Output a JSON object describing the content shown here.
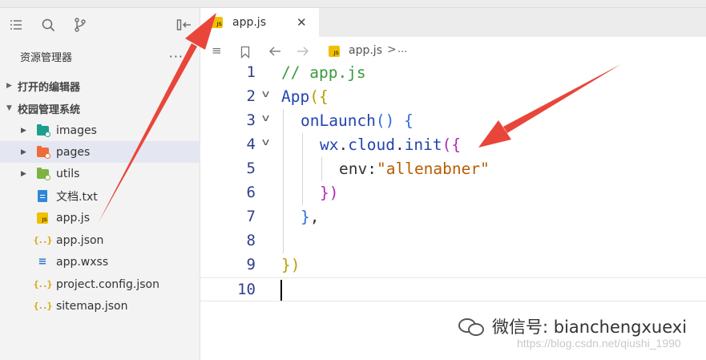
{
  "sidebar": {
    "title": "资源管理器",
    "more": "···",
    "sections": [
      {
        "label": "打开的编辑器"
      },
      {
        "label": "校园管理系统"
      }
    ],
    "items": [
      {
        "label": "images",
        "type": "folder",
        "color": "#1e9e8f"
      },
      {
        "label": "pages",
        "type": "folder",
        "color": "#f06b3b"
      },
      {
        "label": "utils",
        "type": "folder",
        "color": "#7cb342"
      },
      {
        "label": "文档.txt",
        "type": "txt"
      },
      {
        "label": "app.js",
        "type": "js"
      },
      {
        "label": "app.json",
        "type": "json"
      },
      {
        "label": "app.wxss",
        "type": "wxss"
      },
      {
        "label": "project.config.json",
        "type": "json"
      },
      {
        "label": "sitemap.json",
        "type": "json"
      }
    ],
    "selected_item": "pages"
  },
  "editor": {
    "tab": {
      "label": "app.js",
      "close": "✕",
      "icon_text": "JS"
    },
    "breadcrumb": {
      "file": "app.js",
      "sep": ">",
      "rest": "..."
    },
    "lines": [
      {
        "num": "1",
        "text": "// app.js"
      },
      {
        "num": "2",
        "text": "App({"
      },
      {
        "num": "3",
        "text": "onLaunch() {"
      },
      {
        "num": "4",
        "text": "wx.cloud.init({"
      },
      {
        "num": "5",
        "text": "env:\"allenabner\""
      },
      {
        "num": "6",
        "text": "})"
      },
      {
        "num": "7",
        "text": "},"
      },
      {
        "num": "8",
        "text": ""
      },
      {
        "num": "9",
        "text": "})"
      },
      {
        "num": "10",
        "text": ""
      }
    ],
    "tokens": {
      "comment": "// app.js",
      "app": "App",
      "brace_open_1": "({",
      "onlaunch": "onLaunch",
      "paren": "()",
      "brace_open_2": " {",
      "wx": "wx",
      "dot": ".",
      "cloud": "cloud",
      "init": "init",
      "brace_open_3": "({",
      "env_key": "env",
      "colon": ":",
      "env_value": "\"allenabner\"",
      "brace_close_3": "})",
      "brace_close_2": "}",
      "comma": ",",
      "brace_close_1": "})"
    }
  },
  "watermark": {
    "text": "微信号: bianchengxuexi",
    "url": "https://blog.csdn.net/qiushi_1990"
  },
  "colors": {
    "arrow": "#e8463a",
    "selected_row": "#e4e6f1",
    "line_number": "#2f3e8f"
  }
}
